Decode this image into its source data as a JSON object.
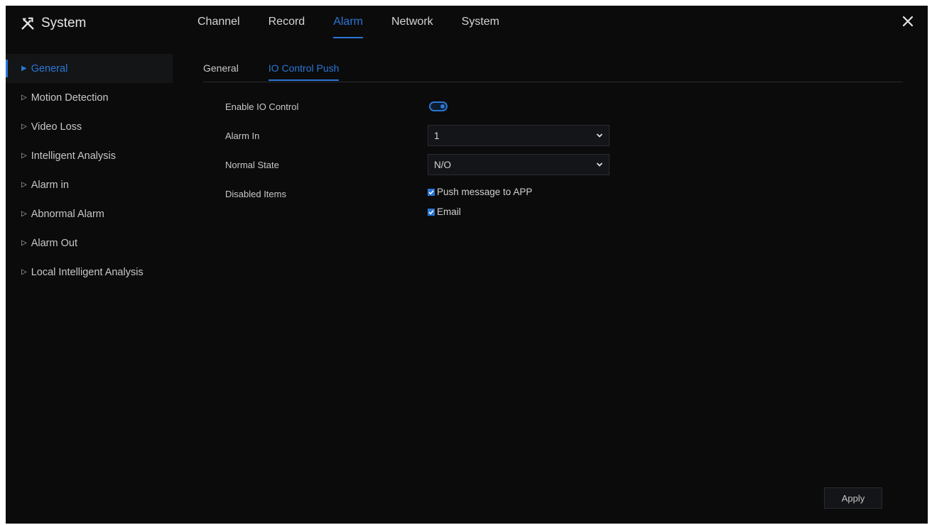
{
  "header": {
    "title": "System",
    "tabs": [
      {
        "label": "Channel",
        "active": false
      },
      {
        "label": "Record",
        "active": false
      },
      {
        "label": "Alarm",
        "active": true
      },
      {
        "label": "Network",
        "active": false
      },
      {
        "label": "System",
        "active": false
      }
    ],
    "close_icon": "close-icon",
    "title_icon": "tools-icon"
  },
  "sidebar": {
    "items": [
      {
        "label": "General",
        "active": true
      },
      {
        "label": "Motion Detection",
        "active": false
      },
      {
        "label": "Video Loss",
        "active": false
      },
      {
        "label": "Intelligent Analysis",
        "active": false
      },
      {
        "label": "Alarm in",
        "active": false
      },
      {
        "label": "Abnormal Alarm",
        "active": false
      },
      {
        "label": "Alarm Out",
        "active": false
      },
      {
        "label": "Local Intelligent Analysis",
        "active": false
      }
    ]
  },
  "subtabs": [
    {
      "label": "General",
      "active": false
    },
    {
      "label": "IO Control Push",
      "active": true
    }
  ],
  "form": {
    "enable_label": "Enable IO Control",
    "enable_on": true,
    "alarm_in_label": "Alarm In",
    "alarm_in_value": "1",
    "normal_state_label": "Normal State",
    "normal_state_value": "N/O",
    "disabled_items_label": "Disabled Items",
    "disabled_items": [
      {
        "label": "Push message to APP",
        "checked": true
      },
      {
        "label": "Email",
        "checked": true
      }
    ]
  },
  "apply_label": "Apply",
  "colors": {
    "accent": "#2a77d4",
    "background": "#0b0b0c",
    "text": "#c8c8c8"
  }
}
